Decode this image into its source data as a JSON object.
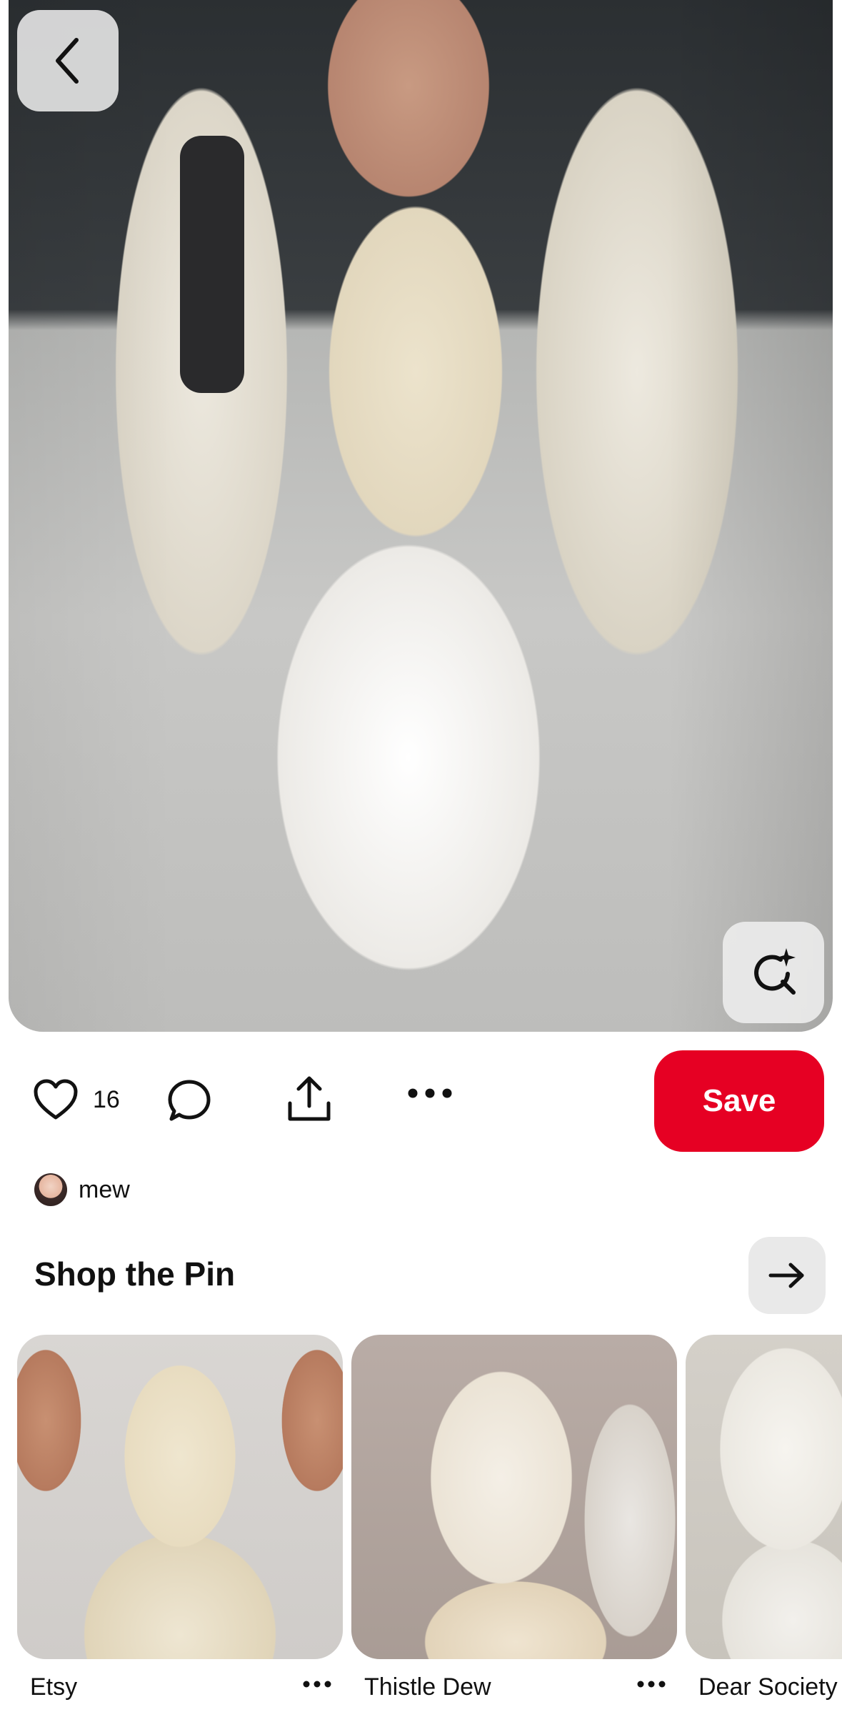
{
  "pin": {
    "likes_count": "16",
    "author": {
      "name": "mew"
    },
    "save_label": "Save"
  },
  "shop": {
    "title": "Shop the Pin",
    "items": [
      {
        "label": "Etsy"
      },
      {
        "label": "Thistle Dew"
      },
      {
        "label": "Dear Society"
      }
    ]
  },
  "colors": {
    "save_button": "#e60023",
    "icon_button_bg": "#e9e9e9"
  },
  "icons": {
    "back": "chevron-left-icon",
    "visual_search": "visual-search-sparkle-icon",
    "like": "heart-icon",
    "comment": "comment-bubble-icon",
    "share": "share-upload-icon",
    "more": "ellipsis-icon",
    "shop_arrow": "arrow-right-icon"
  }
}
